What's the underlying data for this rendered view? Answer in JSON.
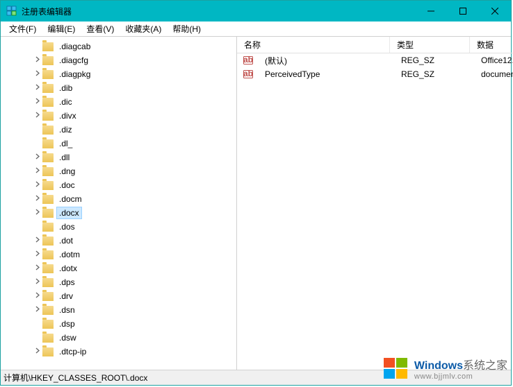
{
  "window": {
    "title": "注册表编辑器"
  },
  "menu": {
    "file": "文件(F)",
    "edit": "编辑(E)",
    "view": "查看(V)",
    "favorites": "收藏夹(A)",
    "help": "帮助(H)"
  },
  "tree": {
    "items": [
      {
        "label": ".diagcab",
        "expandable": false
      },
      {
        "label": ".diagcfg",
        "expandable": true
      },
      {
        "label": ".diagpkg",
        "expandable": true
      },
      {
        "label": ".dib",
        "expandable": true
      },
      {
        "label": ".dic",
        "expandable": true
      },
      {
        "label": ".divx",
        "expandable": true
      },
      {
        "label": ".diz",
        "expandable": false
      },
      {
        "label": ".dl_",
        "expandable": false
      },
      {
        "label": ".dll",
        "expandable": true
      },
      {
        "label": ".dng",
        "expandable": true
      },
      {
        "label": ".doc",
        "expandable": true
      },
      {
        "label": ".docm",
        "expandable": true
      },
      {
        "label": ".docx",
        "expandable": true,
        "selected": true
      },
      {
        "label": ".dos",
        "expandable": false
      },
      {
        "label": ".dot",
        "expandable": true
      },
      {
        "label": ".dotm",
        "expandable": true
      },
      {
        "label": ".dotx",
        "expandable": true
      },
      {
        "label": ".dps",
        "expandable": true
      },
      {
        "label": ".drv",
        "expandable": true
      },
      {
        "label": ".dsn",
        "expandable": true
      },
      {
        "label": ".dsp",
        "expandable": false
      },
      {
        "label": ".dsw",
        "expandable": false
      },
      {
        "label": ".dtcp-ip",
        "expandable": true
      }
    ]
  },
  "list": {
    "columns": {
      "name": "名称",
      "type": "类型",
      "data": "数据"
    },
    "rows": [
      {
        "name": "(默认)",
        "type": "REG_SZ",
        "data": "Office12."
      },
      {
        "name": "PerceivedType",
        "type": "REG_SZ",
        "data": "documen"
      }
    ]
  },
  "statusbar": {
    "path": "计算机\\HKEY_CLASSES_ROOT\\.docx"
  },
  "watermark": {
    "brand1": "Windows",
    "brand2": "系统之家",
    "url": "www.bjjmlv.com"
  }
}
